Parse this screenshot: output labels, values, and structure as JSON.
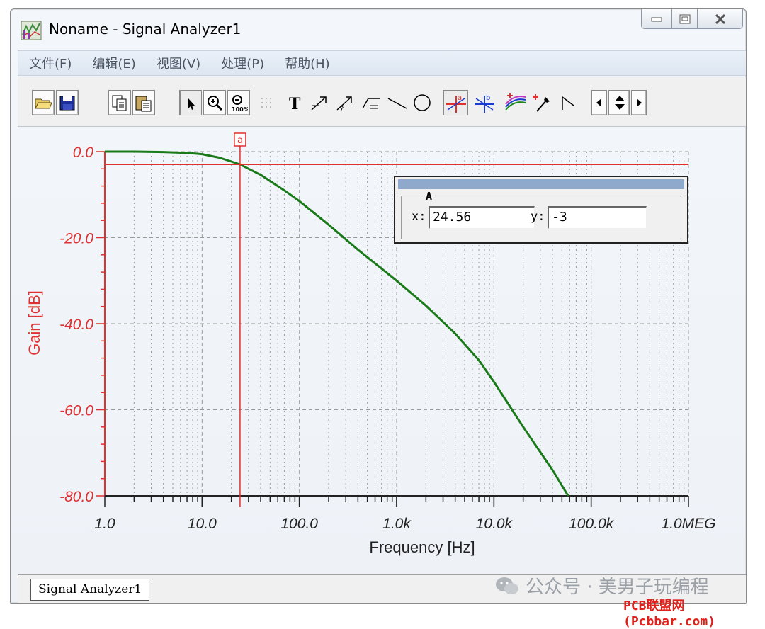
{
  "window": {
    "title": "Noname - Signal Analyzer1",
    "icon": "signal-analyzer-icon"
  },
  "window_controls": [
    "minimize-icon",
    "maximize-icon",
    "close-icon"
  ],
  "menu": [
    {
      "label": "文件(F)"
    },
    {
      "label": "编辑(E)"
    },
    {
      "label": "视图(V)"
    },
    {
      "label": "处理(P)"
    },
    {
      "label": "帮助(H)"
    }
  ],
  "toolbar": [
    "open-folder-icon",
    "save-icon",
    "copy-icon",
    "paste-icon",
    "pointer-icon",
    "zoom-in-icon",
    "zoom-100-icon",
    "grid-icon",
    "text-icon",
    "arrow-tool-icon",
    "arrow-tool-2-icon",
    "waveform-icon",
    "line-icon",
    "circle-icon",
    "cursor-a-icon",
    "cursor-b-icon",
    "add-curve-icon",
    "add-marker-icon",
    "corner-icon",
    "scroll-left-icon",
    "scroll-up-down-icon",
    "scroll-right-icon"
  ],
  "colors": {
    "axis": "#e03030",
    "curve": "#1a7a1a",
    "cursor_line": "#e03030",
    "panel_title": "#8ea9cb"
  },
  "chart_data": {
    "type": "line",
    "xlabel": "Frequency [Hz]",
    "ylabel": "Gain [dB]",
    "x_scale": "log",
    "xlim": [
      1,
      1000000
    ],
    "ylim": [
      -80,
      0
    ],
    "x_ticks": [
      {
        "value": 1,
        "label": "1.0"
      },
      {
        "value": 10,
        "label": "10.0"
      },
      {
        "value": 100,
        "label": "100.0"
      },
      {
        "value": 1000,
        "label": "1.0k"
      },
      {
        "value": 10000,
        "label": "10.0k"
      },
      {
        "value": 100000,
        "label": "100.0k"
      },
      {
        "value": 1000000,
        "label": "1.0MEG"
      }
    ],
    "y_ticks": [
      {
        "value": 0,
        "label": "0.0"
      },
      {
        "value": -20,
        "label": "-20.0"
      },
      {
        "value": -40,
        "label": "-40.0"
      },
      {
        "value": -60,
        "label": "-60.0"
      },
      {
        "value": -80,
        "label": "-80.0"
      }
    ],
    "grid": true,
    "series": [
      {
        "x": [
          1,
          2,
          4,
          7,
          10,
          15,
          20,
          24.56,
          40,
          70,
          100,
          200,
          400,
          700,
          1000,
          2000,
          4000,
          7000,
          10000,
          20000,
          40000,
          58000
        ],
        "y": [
          0,
          0,
          -0.1,
          -0.3,
          -0.6,
          -1.4,
          -2.3,
          -3,
          -5.4,
          -9,
          -11.5,
          -17,
          -22.8,
          -27.2,
          -30,
          -35.8,
          -42.3,
          -48.5,
          -53.5,
          -64,
          -74,
          -80
        ]
      }
    ],
    "cursor": {
      "label": "a",
      "x": 24.56,
      "y": -3
    }
  },
  "cursor_panel": {
    "group_label": "A",
    "x_label": "x:",
    "x_value": "24.56",
    "y_label": "y:",
    "y_value": "-3"
  },
  "tab": {
    "label": "Signal Analyzer1"
  },
  "watermark": {
    "text": "公众号 · 美男子玩编程"
  },
  "footer_brand": "PCB联盟网(Pcbbar.com)"
}
